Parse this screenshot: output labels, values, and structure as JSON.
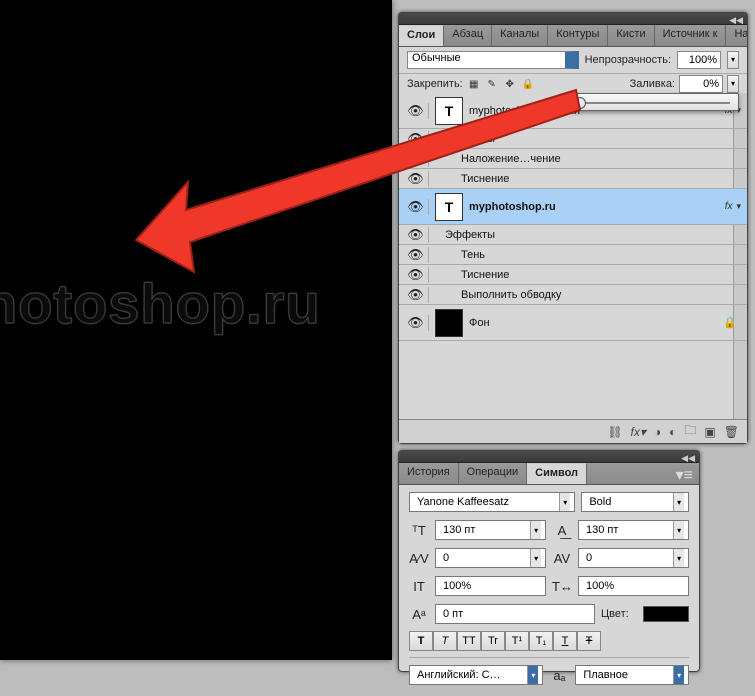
{
  "canvas": {
    "text": "hotoshop.ru"
  },
  "layers_panel": {
    "tabs": [
      "Слои",
      "Абзац",
      "Каналы",
      "Контуры",
      "Кисти",
      "Источник к",
      "Наборы ки"
    ],
    "active_tab": 0,
    "blend_mode": "Обычные",
    "opacity_label": "Непрозрачность:",
    "opacity_value": "100%",
    "lock_label": "Закрепить:",
    "fill_label": "Заливка:",
    "fill_value": "0%",
    "layers": [
      {
        "name": "myphotoshop.ru копия",
        "type": "text",
        "fx": true
      },
      {
        "name": "Эффекты",
        "type": "fxhead"
      },
      {
        "name": "Наложение…чение",
        "type": "fxitem"
      },
      {
        "name": "Тиснение",
        "type": "fxitem"
      },
      {
        "name": "myphotoshop.ru",
        "type": "text",
        "fx": true,
        "selected": true
      },
      {
        "name": "Эффекты",
        "type": "fxhead"
      },
      {
        "name": "Тень",
        "type": "fxitem"
      },
      {
        "name": "Тиснение",
        "type": "fxitem"
      },
      {
        "name": "Выполнить обводку",
        "type": "fxitem"
      },
      {
        "name": "Фон",
        "type": "bg",
        "locked": true
      }
    ]
  },
  "char_panel": {
    "tabs": [
      "История",
      "Операции",
      "Символ"
    ],
    "active_tab": 2,
    "font_family": "Yanone Kaffeesatz",
    "font_style": "Bold",
    "font_size": "130 пт",
    "leading": "130 пт",
    "kerning": "0",
    "tracking": "0",
    "vscale": "100%",
    "hscale": "100%",
    "baseline": "0 пт",
    "color_label": "Цвет:",
    "language": "Английский: С…",
    "aa_label": "aₐ",
    "aa_method": "Плавное",
    "style_glyphs": [
      "T",
      "T",
      "TT",
      "Tr",
      "T¹",
      "T₁",
      "T",
      "Ŧ"
    ]
  }
}
